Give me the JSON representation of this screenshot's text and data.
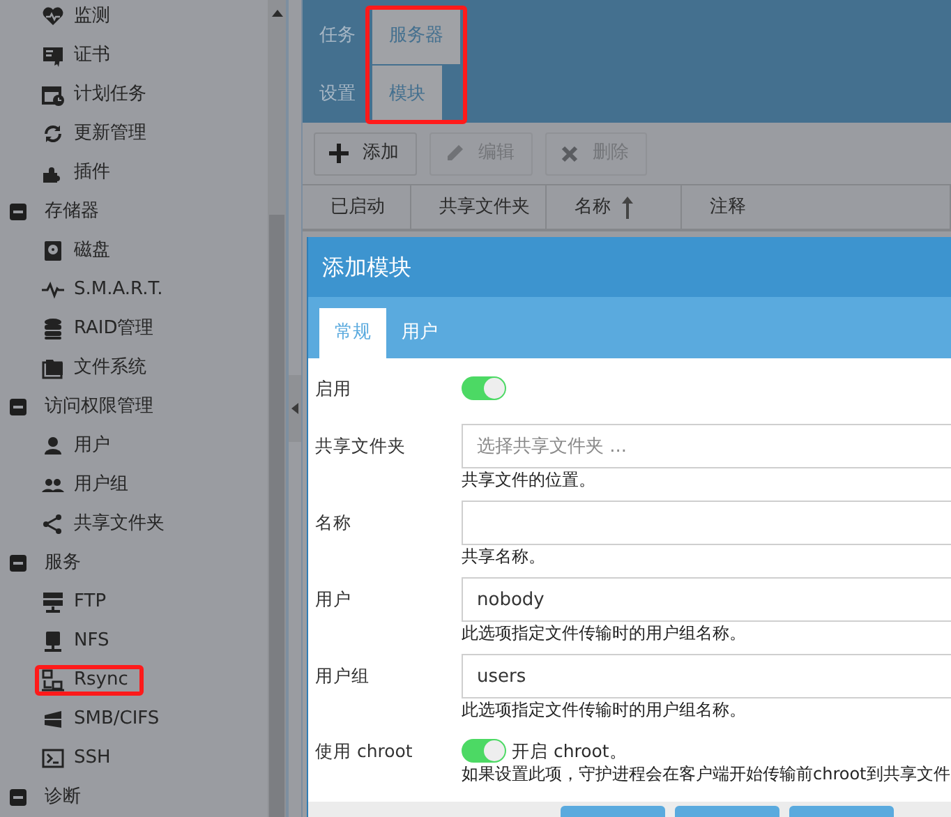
{
  "sidebar": {
    "groups": [
      {
        "children": [
          {
            "label": "监测"
          },
          {
            "label": "证书"
          },
          {
            "label": "计划任务"
          },
          {
            "label": "更新管理"
          },
          {
            "label": "插件"
          }
        ]
      },
      {
        "label": "存储器",
        "expanded": true,
        "children": [
          {
            "label": "磁盘"
          },
          {
            "label": "S.M.A.R.T."
          },
          {
            "label": "RAID管理"
          },
          {
            "label": "文件系统"
          }
        ]
      },
      {
        "label": "访问权限管理",
        "expanded": true,
        "children": [
          {
            "label": "用户"
          },
          {
            "label": "用户组"
          },
          {
            "label": "共享文件夹"
          }
        ]
      },
      {
        "label": "服务",
        "expanded": true,
        "children": [
          {
            "label": "FTP"
          },
          {
            "label": "NFS"
          },
          {
            "label": "Rsync",
            "highlighted": true
          },
          {
            "label": "SMB/CIFS"
          },
          {
            "label": "SSH"
          }
        ]
      },
      {
        "label": "诊断",
        "expanded": true
      }
    ]
  },
  "header_tabs": [
    [
      {
        "label": "任务",
        "selected": false,
        "highlighted": false
      },
      {
        "label": "服务器",
        "selected": true,
        "highlighted": true
      }
    ],
    [
      {
        "label": "设置",
        "selected": false,
        "highlighted": false
      },
      {
        "label": "模块",
        "selected": true,
        "highlighted": true
      }
    ]
  ],
  "toolbar": [
    {
      "label": "添加",
      "disabled": false
    },
    {
      "label": "编辑",
      "disabled": true
    },
    {
      "label": "删除",
      "disabled": true
    }
  ],
  "table": {
    "columns": [
      {
        "label": "已启动"
      },
      {
        "label": "共享文件夹"
      },
      {
        "label": "名称",
        "sorted": true
      },
      {
        "label": "注释"
      }
    ]
  },
  "dialog": {
    "title": "添加模块",
    "tabs": [
      {
        "label": "常规",
        "selected": true
      },
      {
        "label": "用户",
        "selected": false
      }
    ],
    "fields": [
      {
        "kind": "switch",
        "label": "启用",
        "on": true
      },
      {
        "kind": "text",
        "label": "共享文件夹",
        "placeholder": "选择共享文件夹 ...",
        "help": "共享文件的位置。"
      },
      {
        "kind": "text",
        "label": "名称",
        "help": "共享名称。"
      },
      {
        "kind": "text",
        "label": "用户",
        "value": "nobody",
        "help": "此选项指定文件传输时的用户组名称。"
      },
      {
        "kind": "text",
        "label": "用户组",
        "value": "users",
        "help": "此选项指定文件传输时的用户组名称。"
      },
      {
        "kind": "switch",
        "label": "使用 chroot",
        "on": true,
        "caption": "开启 chroot。",
        "help": "如果设置此项，守护进程会在客户端开始传输前chroot到共享文件"
      }
    ]
  }
}
